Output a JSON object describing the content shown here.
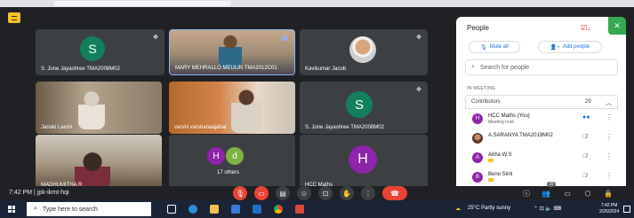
{
  "meeting": {
    "time": "7:42 PM",
    "separator": "|",
    "code": "jpk-ikmt-hqi"
  },
  "tiles": [
    {
      "name": "S. Jone Jayashree TMA2008M02",
      "initial": "S",
      "color": "#12805c"
    },
    {
      "name": "MARY MEHRALLO MEULIN TMA2012C01"
    },
    {
      "name": "Kavikumar Jacob"
    },
    {
      "name": "Janaki Laxmi"
    },
    {
      "name": "varshi varshanaajahar"
    },
    {
      "name": "S. Jone Jayashree TMA2008M02",
      "initial": "S",
      "color": "#12805c"
    },
    {
      "name": "MADHUMITHA R"
    },
    {
      "name": "17 others",
      "initials": [
        "H",
        "d"
      ],
      "colors": [
        "#8e24aa",
        "#7cb342"
      ]
    },
    {
      "name": "HCC Maths",
      "initial": "H",
      "color": "#8e24aa"
    }
  ],
  "panel": {
    "title": "People",
    "mute_all": "Mute all",
    "add_people": "Add people",
    "search_placeholder": "Search for people",
    "section_label": "IN MEETING",
    "contributors_label": "Contributors",
    "contributors_count": "29",
    "people": [
      {
        "initial": "H",
        "name": "HCC Maths (You)",
        "sub": "Meeting host",
        "color": "#8e24aa"
      },
      {
        "initial": "",
        "name": "A.SARANYA TMA2019M02",
        "sub": "",
        "color": "#795548"
      },
      {
        "initial": "A",
        "name": "Abha W.S",
        "sub": "",
        "color": "#8e24aa"
      },
      {
        "initial": "B",
        "name": "Beno Siml",
        "sub": "",
        "color": "#8e24aa"
      }
    ]
  },
  "controls": {
    "raise_count": "29"
  },
  "taskbar": {
    "search_placeholder": "Type here to search",
    "weather": "25°C  Partly sunny",
    "time": "7:42 PM",
    "date": "2/26/2024"
  }
}
